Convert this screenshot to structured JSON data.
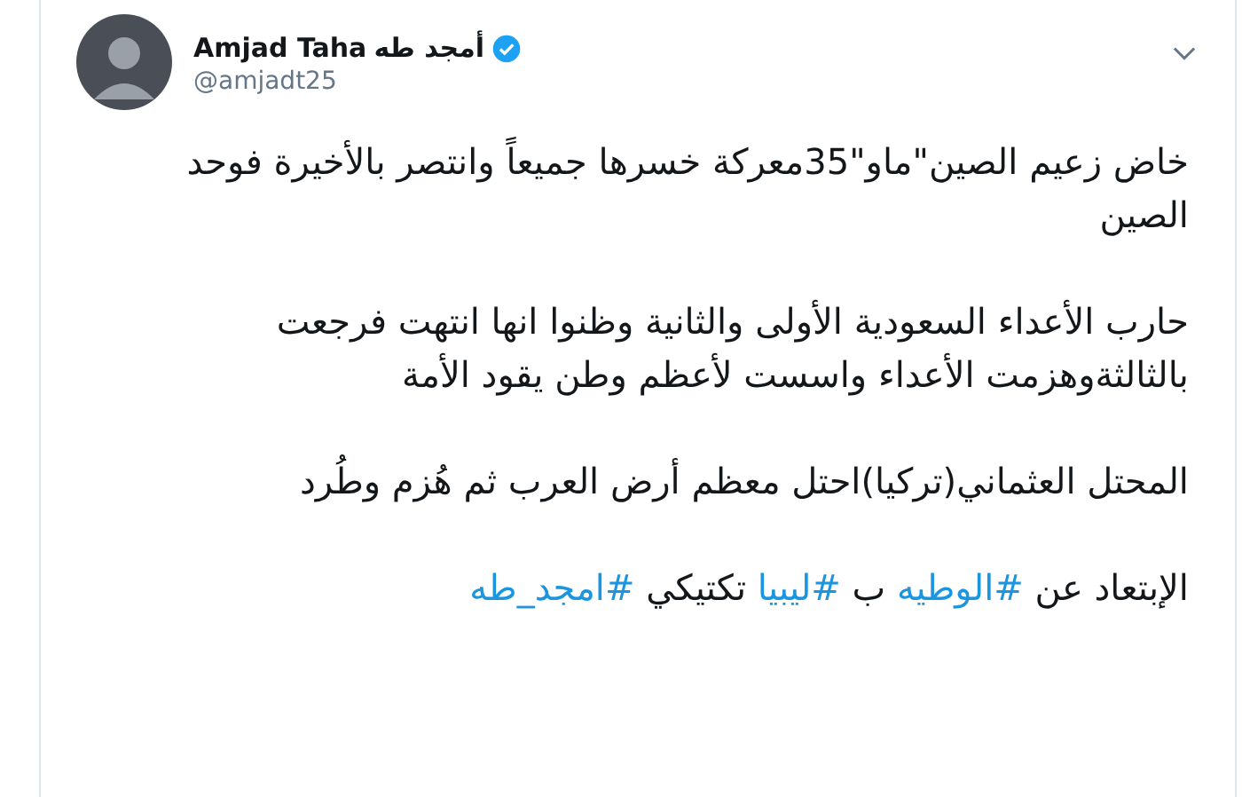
{
  "tweet": {
    "author_name": "Amjad Taha",
    "author_name_ar": "أمجد طه",
    "verified": true,
    "handle": "@amjadt25",
    "paragraphs": [
      [
        {
          "kind": "text",
          "text": "خاض زعيم الصين\"ماو\"35معركة خسرها جميعاً وانتصر بالأخيرة فوحد الصين"
        }
      ],
      [
        {
          "kind": "text",
          "text": "حارب الأعداء السعودية الأولى والثانية وظنوا انها انتهت فرجعت بالثالثةوهزمت الأعداء واسست لأعظم وطن يقود الأمة"
        }
      ],
      [
        {
          "kind": "text",
          "text": "المحتل العثماني(تركيا)احتل معظم أرض العرب ثم هُزم وطُرد"
        }
      ],
      [
        {
          "kind": "text",
          "text": "الإبتعاد عن "
        },
        {
          "kind": "hashtag",
          "text": "#الوطيه"
        },
        {
          "kind": "text",
          "text": " ب "
        },
        {
          "kind": "hashtag",
          "text": "#ليبيا"
        },
        {
          "kind": "text",
          "text": " تكتيكي "
        },
        {
          "kind": "hashtag",
          "text": "#امجد_طه"
        }
      ]
    ]
  }
}
